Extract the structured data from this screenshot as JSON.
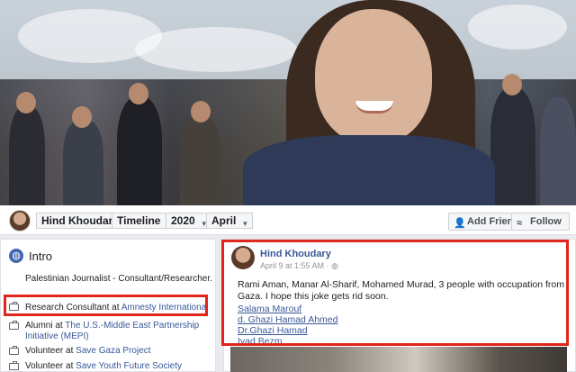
{
  "profile": {
    "name": "Hind Khoudary"
  },
  "timeline_nav": {
    "timeline_label": "Timeline",
    "year": "2020",
    "month": "April",
    "add_friend_label": "Add Friend",
    "follow_label": "Follow"
  },
  "intro": {
    "title": "Intro",
    "bio": "Palestinian Journalist - Consultant/Researcher.",
    "items": [
      {
        "prefix": "Research Consultant at ",
        "link": "Amnesty International"
      },
      {
        "prefix": "Alumni at ",
        "link": "The U.S.-Middle East Partnership Initiative (MEPI)"
      },
      {
        "prefix": "Volunteer at ",
        "link": "Save Gaza Project"
      },
      {
        "prefix": "Volunteer at ",
        "link": "Save Youth Future Society"
      }
    ]
  },
  "post": {
    "author": "Hind Khoudary",
    "time": "April 9 at 1:55 AM ·",
    "text": "Rami Aman, Manar Al-Sharif, Mohamed Murad, 3 people with occupation from Gaza. I hope this joke gets rid soon.",
    "tags": [
      "Salama Marouf",
      "d. Ghazi Hamad Ahmed",
      "Dr.Ghazi Hamad",
      "Iyad Bezm"
    ]
  },
  "colors": {
    "highlight": "#e0261b",
    "link": "#385898",
    "facebook_blue": "#4267b2"
  }
}
